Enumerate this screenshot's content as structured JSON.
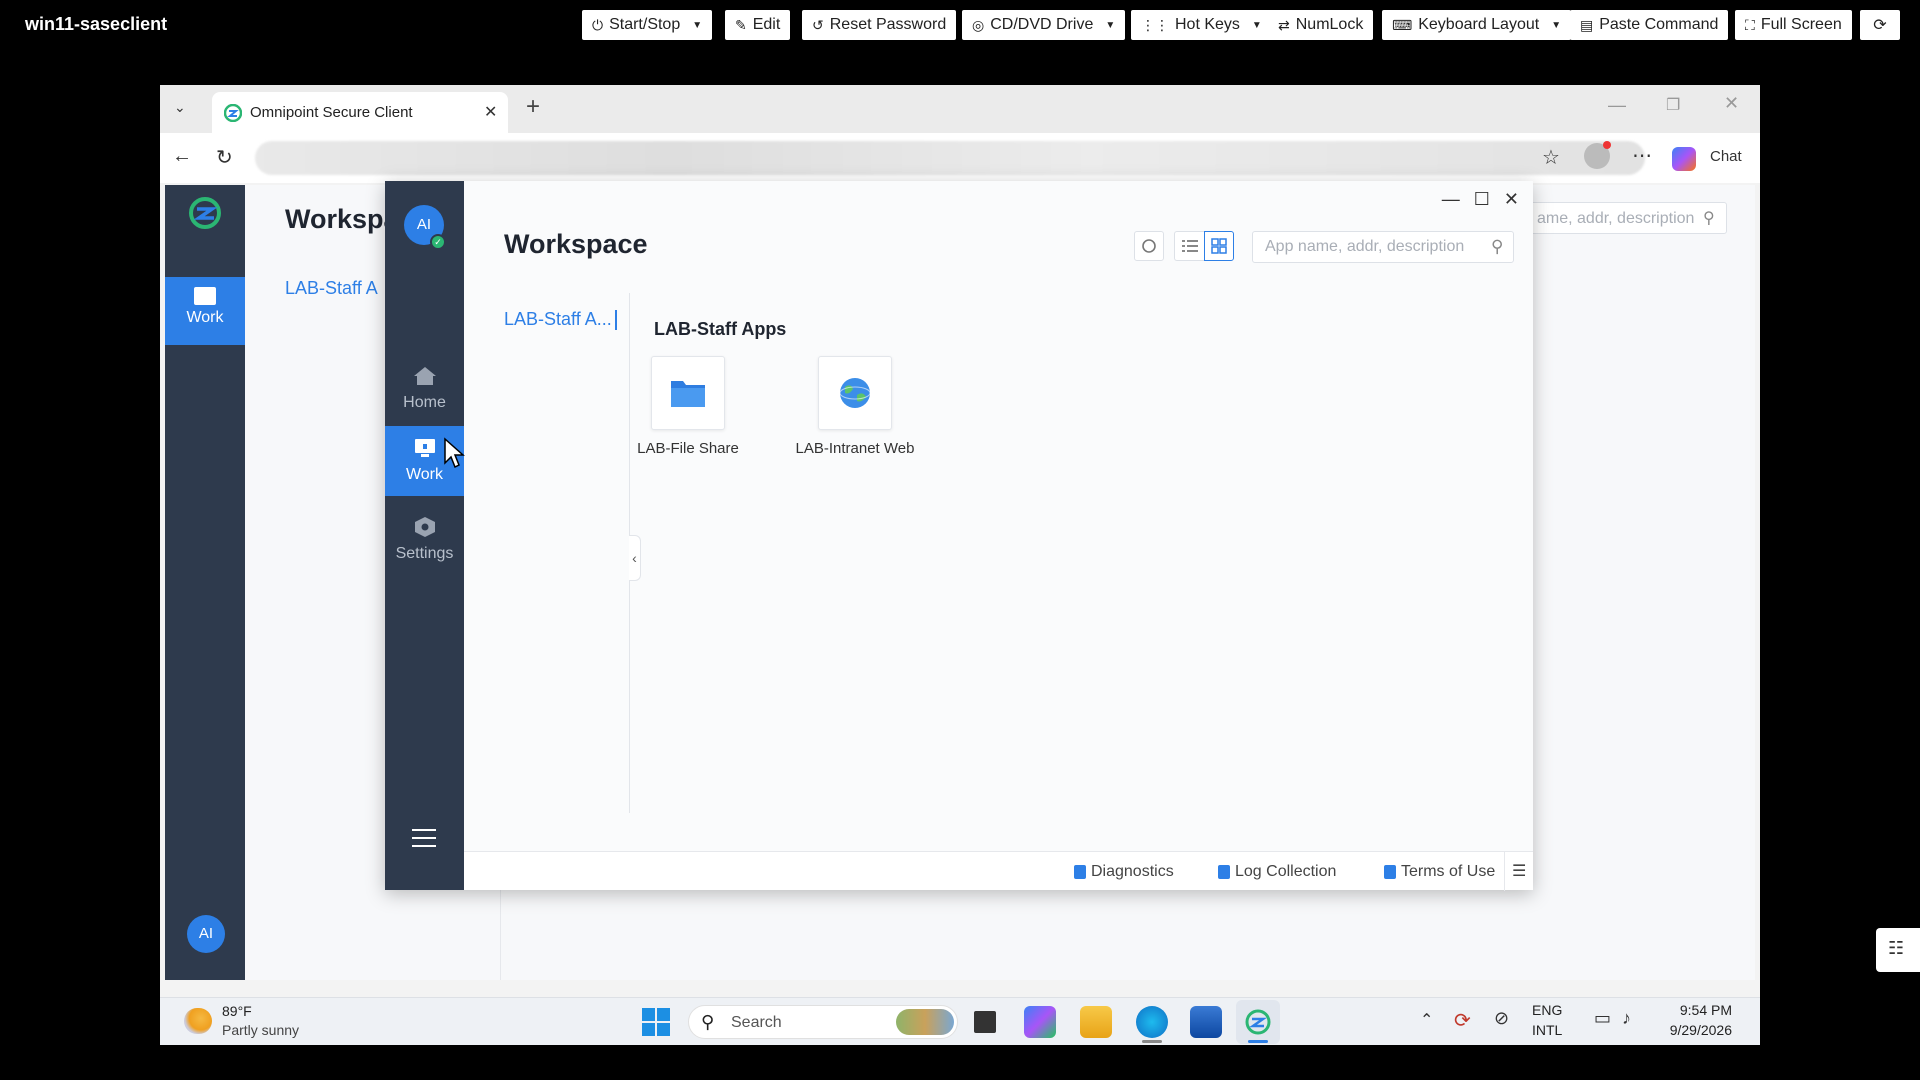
{
  "console": {
    "vm_name": "win11-saseclient",
    "buttons": [
      {
        "label": "Start/Stop",
        "icon": "power-icon",
        "dropdown": true
      },
      {
        "label": "Edit",
        "icon": "pencil-icon",
        "dropdown": false
      },
      {
        "label": "Reset Password",
        "icon": "reset-icon",
        "dropdown": false
      },
      {
        "label": "CD/DVD Drive",
        "icon": "disc-icon",
        "dropdown": true
      },
      {
        "label": "Hot Keys",
        "icon": "grid-icon",
        "dropdown": true
      },
      {
        "label": "NumLock",
        "icon": "swap-icon",
        "dropdown": false
      },
      {
        "label": "Keyboard Layout",
        "icon": "keyboard-icon",
        "dropdown": true
      },
      {
        "label": "Paste Command",
        "icon": "paste-icon",
        "dropdown": false
      },
      {
        "label": "Full Screen",
        "icon": "fullscreen-icon",
        "dropdown": false
      }
    ]
  },
  "browser": {
    "tab_title": "Omnipoint Secure Client",
    "chat_label": "Chat"
  },
  "background_app": {
    "title": "Workspa",
    "nav_active": "Work",
    "group": "LAB-Staff A",
    "search_placeholder": "ame, addr, description",
    "avatar": "AI"
  },
  "client": {
    "avatar": "AI",
    "nav": [
      {
        "label": "Home",
        "icon": "home-icon",
        "active": false
      },
      {
        "label": "Work",
        "icon": "desktop-icon",
        "active": true
      },
      {
        "label": "Settings",
        "icon": "gear-icon",
        "active": false
      }
    ],
    "title": "Workspace",
    "search_placeholder": "App name, addr, description",
    "group_nav": "LAB-Staff A...",
    "section_title": "LAB-Staff Apps",
    "apps": [
      {
        "label": "LAB-File Share",
        "icon": "folder-icon"
      },
      {
        "label": "LAB-Intranet Web",
        "icon": "globe-icon"
      }
    ],
    "footer": [
      "Diagnostics",
      "Log Collection",
      "Terms of Use"
    ]
  },
  "taskbar": {
    "weather_temp": "89°F",
    "weather_desc": "Partly sunny",
    "search_label": "Search",
    "lang_top": "ENG",
    "lang_bottom": "INTL",
    "time": "9:54 PM",
    "date": "9/29/2026"
  },
  "colors": {
    "accent": "#2d7fe6",
    "sidebar": "#2e3a4d"
  }
}
